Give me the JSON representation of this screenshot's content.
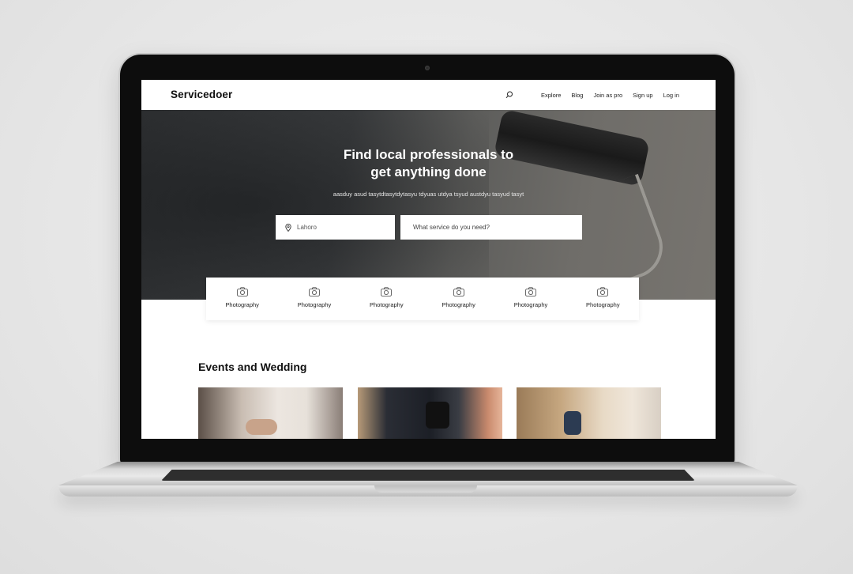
{
  "site": {
    "logo": "Servicedoer",
    "nav": {
      "links": [
        "Explore",
        "Blog",
        "Join as pro",
        "Sign up",
        "Log in"
      ]
    }
  },
  "hero": {
    "title_line1": "Find local professionals to",
    "title_line2": "get anything done",
    "subtitle": "aasduy asud tasytdtasytdytasyu tdyuas utdya tsyud austdyu tasyud tasyt",
    "location_value": "Lahoro",
    "service_placeholder": "What service do you need?"
  },
  "categories": [
    {
      "label": "Photography",
      "icon": "camera-icon"
    },
    {
      "label": "Photography",
      "icon": "camera-icon"
    },
    {
      "label": "Photography",
      "icon": "camera-icon"
    },
    {
      "label": "Photography",
      "icon": "camera-icon"
    },
    {
      "label": "Photography",
      "icon": "camera-icon"
    },
    {
      "label": "Photography",
      "icon": "camera-icon"
    }
  ],
  "section": {
    "title": "Events and Wedding"
  },
  "colors": {
    "background": "#e6e6e6",
    "text_dark": "#111111",
    "hero_dark": "#2f3133"
  }
}
